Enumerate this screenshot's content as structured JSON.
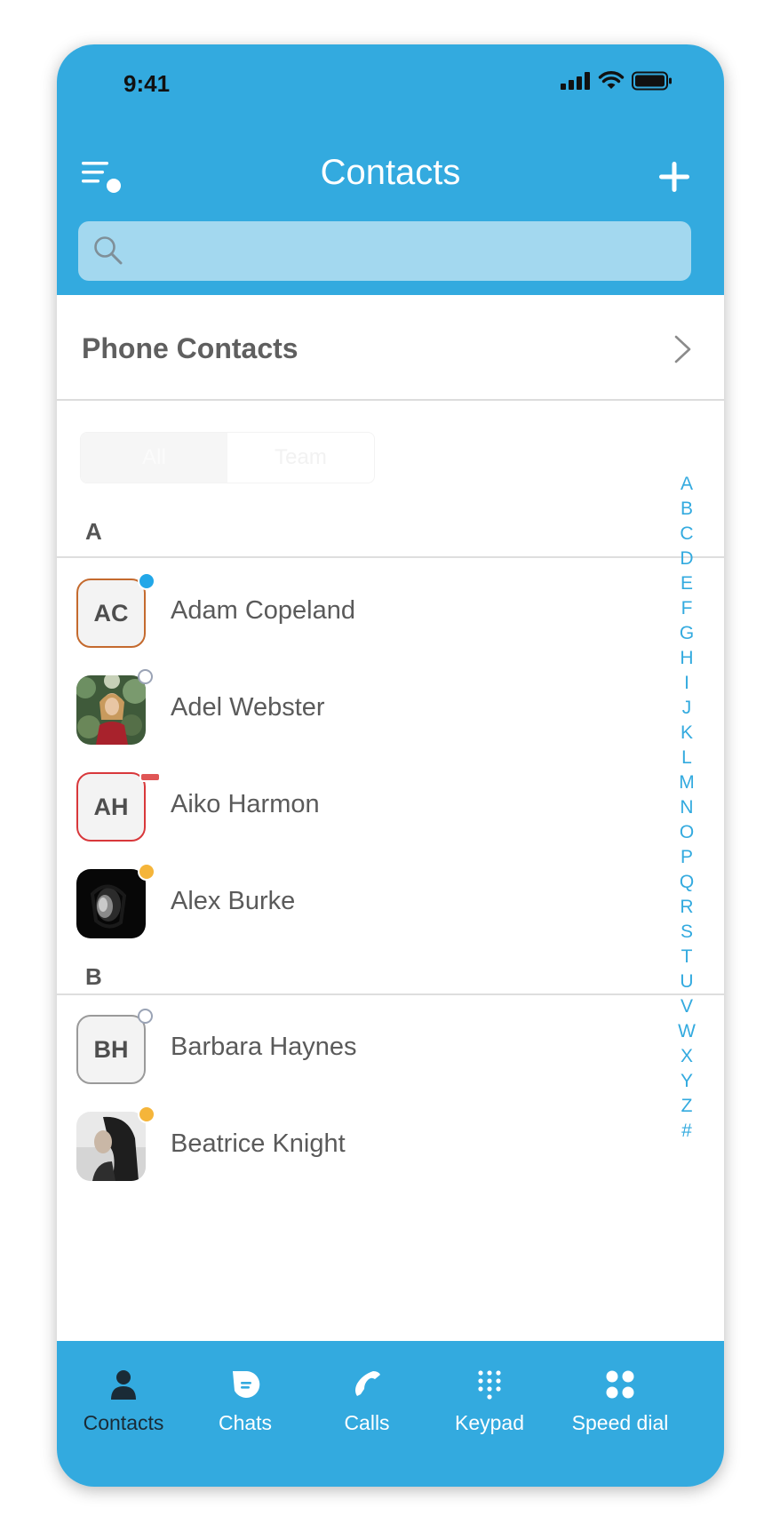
{
  "status_bar": {
    "time": "9:41"
  },
  "header": {
    "title": "Contacts"
  },
  "search": {
    "placeholder": ""
  },
  "phone_contacts": {
    "label": "Phone Contacts"
  },
  "segment": {
    "tabs": [
      "All",
      "Team"
    ]
  },
  "sections": [
    {
      "letter": "A",
      "contacts": [
        {
          "name": "Adam Copeland",
          "initials": "AC",
          "avatar": "initials",
          "border_color": "#c46a2e",
          "status_color": "#22a7e8"
        },
        {
          "name": "Adel Webster",
          "avatar": "photo-woman-foliage-icon",
          "status_color": "hollow"
        },
        {
          "name": "Aiko Harmon",
          "initials": "AH",
          "avatar": "initials",
          "border_color": "#d8383b",
          "status_color": "#e05555",
          "status_shape": "dash"
        },
        {
          "name": "Alex Burke",
          "avatar": "photo-dark-portrait-icon",
          "status_color": "#f5b53a"
        }
      ]
    },
    {
      "letter": "B",
      "contacts": [
        {
          "name": "Barbara Haynes",
          "initials": "BH",
          "avatar": "initials",
          "border_color": "#9a9a9a",
          "status_color": "hollow"
        },
        {
          "name": "Beatrice Knight",
          "avatar": "photo-woman-profile-icon",
          "status_color": "#f5b53a"
        }
      ]
    }
  ],
  "alphabet": [
    "A",
    "B",
    "C",
    "D",
    "E",
    "F",
    "G",
    "H",
    "I",
    "J",
    "K",
    "L",
    "M",
    "N",
    "O",
    "P",
    "Q",
    "R",
    "S",
    "T",
    "U",
    "V",
    "W",
    "X",
    "Y",
    "Z",
    "#"
  ],
  "tabbar": {
    "tabs": [
      {
        "label": "Contacts",
        "icon": "person-icon",
        "active": true
      },
      {
        "label": "Chats",
        "icon": "chat-bubble-icon"
      },
      {
        "label": "Calls",
        "icon": "phone-handset-icon"
      },
      {
        "label": "Keypad",
        "icon": "keypad-icon"
      },
      {
        "label": "Speed dial",
        "icon": "speed-dial-icon"
      }
    ]
  },
  "colors": {
    "accent": "#33aadf",
    "search_bg": "#a3d8ef"
  }
}
